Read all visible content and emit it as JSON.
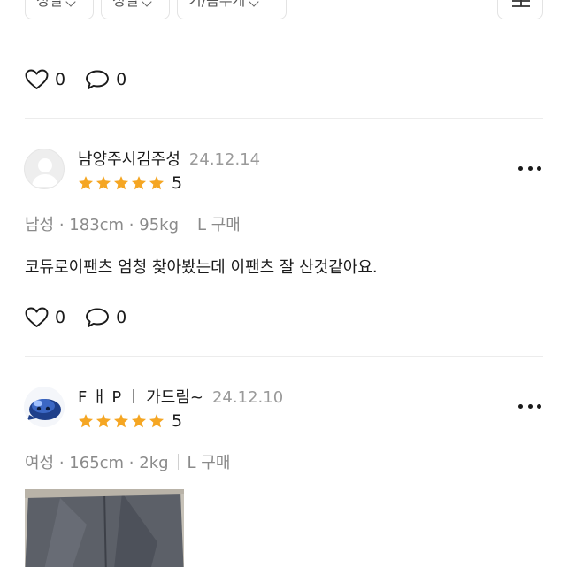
{
  "filters": {
    "chips": [
      {
        "label": "성별"
      },
      {
        "label": "성별"
      },
      {
        "label": "키/몸무게"
      }
    ]
  },
  "first_actions": {
    "likes": "0",
    "comments": "0"
  },
  "reviews": [
    {
      "username": "남양주시김주성",
      "date": "24.12.14",
      "score": "5",
      "meta": {
        "gender": "남성 · 183cm · 95kg",
        "purchase": "L 구매"
      },
      "text": "코듀로이팬츠 엄청 찾아봤는데 이팬츠 잘 산것같아요.",
      "likes": "0",
      "comments": "0"
    },
    {
      "username": "F ㅐ P ㅣ 가드림~",
      "date": "24.12.10",
      "score": "5",
      "meta": {
        "gender": "여성 · 165cm · 2kg",
        "purchase": "L 구매"
      }
    }
  ],
  "colors": {
    "star": "#f5a623",
    "divider": "#ececec",
    "date": "#9a9a9a"
  },
  "icons": [
    "chevron-down-icon",
    "sort-icon",
    "heart-icon",
    "comment-icon",
    "star-icon",
    "more-icon",
    "default-avatar-icon"
  ]
}
